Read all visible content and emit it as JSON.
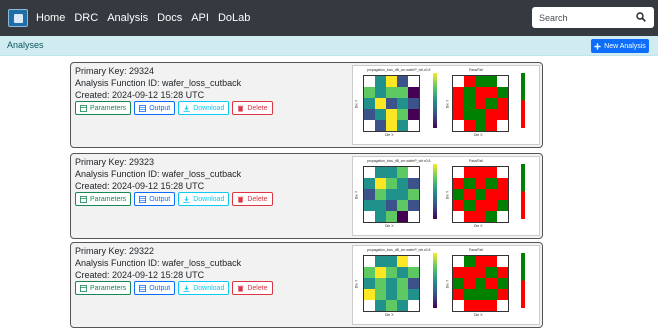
{
  "navbar": {
    "links": [
      "Home",
      "DRC",
      "Analysis",
      "Docs",
      "API",
      "DoLab"
    ],
    "search_placeholder": "Search"
  },
  "subheader": {
    "title": "Analyses",
    "new_label": "New Analysis"
  },
  "buttons": {
    "params": "Parameters",
    "output": "Output",
    "download": "Download",
    "delete": "Delete"
  },
  "analyses": [
    {
      "pk": "Primary Key: 29324",
      "func": "Analysis Function ID: wafer_loss_cutback",
      "created": "Created: 2024-09-12 15:28 UTC"
    },
    {
      "pk": "Primary Key: 29323",
      "func": "Analysis Function ID: wafer_loss_cutback",
      "created": "Created: 2024-09-12 15:28 UTC"
    },
    {
      "pk": "Primary Key: 29322",
      "func": "Analysis Function ID: wafer_loss_cutback",
      "created": "Created: 2024-09-12 15:28 UTC"
    }
  ],
  "figure_text": {
    "left_title": "propagation_loss_dB_cm waferP_wfr.x0.8",
    "right_title": "Pass/Fail",
    "ylabel": "Die Y",
    "xlabel": "Die X"
  },
  "colors": {
    "navbar": "#343a40",
    "subheader": "#d1ecf1",
    "primary": "#0d6efd"
  }
}
